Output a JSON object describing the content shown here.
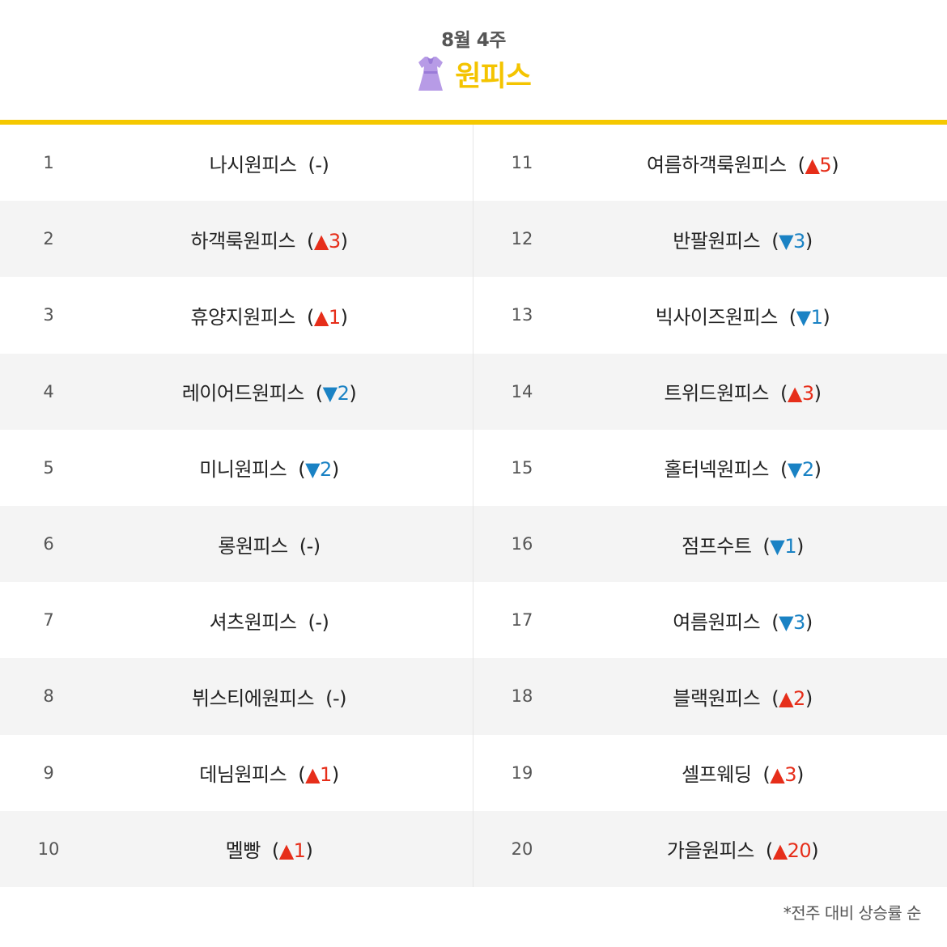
{
  "header": {
    "week": "8월 4주",
    "category": "원피스",
    "category_icon": "dress-icon",
    "accent_color": "#f5c800"
  },
  "colors": {
    "up": "#e62e1a",
    "down": "#1a82c4",
    "row_alt": "#f4f4f4"
  },
  "rankings": [
    {
      "rank": "1",
      "name": "나시원피스",
      "dir": "none",
      "value": "-"
    },
    {
      "rank": "2",
      "name": "하객룩원피스",
      "dir": "up",
      "value": "3"
    },
    {
      "rank": "3",
      "name": "휴양지원피스",
      "dir": "up",
      "value": "1"
    },
    {
      "rank": "4",
      "name": "레이어드원피스",
      "dir": "down",
      "value": "2"
    },
    {
      "rank": "5",
      "name": "미니원피스",
      "dir": "down",
      "value": "2"
    },
    {
      "rank": "6",
      "name": "롱원피스",
      "dir": "none",
      "value": "-"
    },
    {
      "rank": "7",
      "name": "셔츠원피스",
      "dir": "none",
      "value": "-"
    },
    {
      "rank": "8",
      "name": "뷔스티에원피스",
      "dir": "none",
      "value": "-"
    },
    {
      "rank": "9",
      "name": "데님원피스",
      "dir": "up",
      "value": "1"
    },
    {
      "rank": "10",
      "name": "멜빵",
      "dir": "up",
      "value": "1"
    },
    {
      "rank": "11",
      "name": "여름하객룩원피스",
      "dir": "up",
      "value": "5"
    },
    {
      "rank": "12",
      "name": "반팔원피스",
      "dir": "down",
      "value": "3"
    },
    {
      "rank": "13",
      "name": "빅사이즈원피스",
      "dir": "down",
      "value": "1"
    },
    {
      "rank": "14",
      "name": "트위드원피스",
      "dir": "up",
      "value": "3"
    },
    {
      "rank": "15",
      "name": "홀터넥원피스",
      "dir": "down",
      "value": "2"
    },
    {
      "rank": "16",
      "name": "점프수트",
      "dir": "down",
      "value": "1"
    },
    {
      "rank": "17",
      "name": "여름원피스",
      "dir": "down",
      "value": "3"
    },
    {
      "rank": "18",
      "name": "블랙원피스",
      "dir": "up",
      "value": "2"
    },
    {
      "rank": "19",
      "name": "셀프웨딩",
      "dir": "up",
      "value": "3"
    },
    {
      "rank": "20",
      "name": "가을원피스",
      "dir": "up",
      "value": "20"
    }
  ],
  "symbols": {
    "up": "▲",
    "down": "▼",
    "open": "(",
    "close": ")"
  },
  "footnote": "*전주 대비 상승률 순"
}
